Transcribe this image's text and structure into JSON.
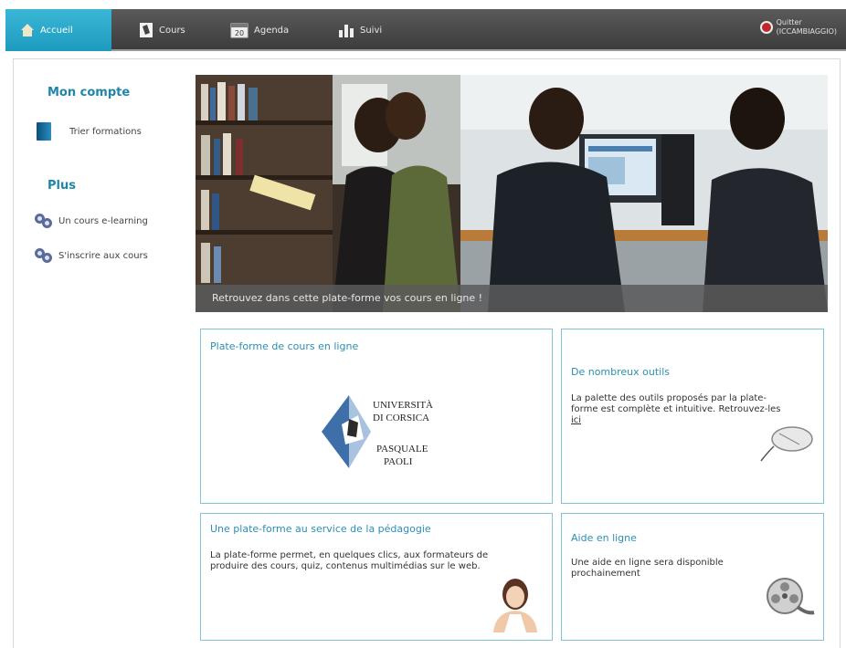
{
  "nav": {
    "items": [
      {
        "label": "Accueil",
        "icon": "home-icon"
      },
      {
        "label": "Cours",
        "icon": "courses-icon"
      },
      {
        "label": "Agenda",
        "icon": "calendar-icon",
        "icon_text": "20"
      },
      {
        "label": "Suivi",
        "icon": "chart-icon"
      }
    ],
    "user": {
      "line1": "Quitter",
      "line2": "(ICCAMBIAGGIO)"
    }
  },
  "sidebar": {
    "account_title": "Mon compte",
    "account_item": "Trier formations",
    "more_title": "Plus",
    "more_items": [
      "Un cours e-learning",
      "S'inscrire aux cours"
    ]
  },
  "banner": {
    "caption": "Retrouvez dans cette plate-forme vos cours en ligne !"
  },
  "cards": {
    "platform": {
      "title": "Plate-forme de cours en ligne",
      "logo_lines": [
        "UNIVERSITÀ",
        "DI CORSICA",
        "PASQUALE",
        "PAOLI"
      ]
    },
    "tools": {
      "title": "De nombreux outils",
      "text": "La palette des outils proposés par la plate-forme est complète et intuitive. Retrouvez-les",
      "link": "ici"
    },
    "pedagogy": {
      "title": "Une plate-forme au service de la pédagogie",
      "text": "La plate-forme permet, en quelques clics, aux formateurs de produire des cours, quiz, contenus multimédias sur le web."
    },
    "help": {
      "title": "Aide en ligne",
      "text": "Une aide en ligne sera disponible prochainement"
    }
  },
  "colors": {
    "accent": "#1d9bbf",
    "title_blue": "#1f86a8",
    "card_border": "#7fc4dc"
  }
}
